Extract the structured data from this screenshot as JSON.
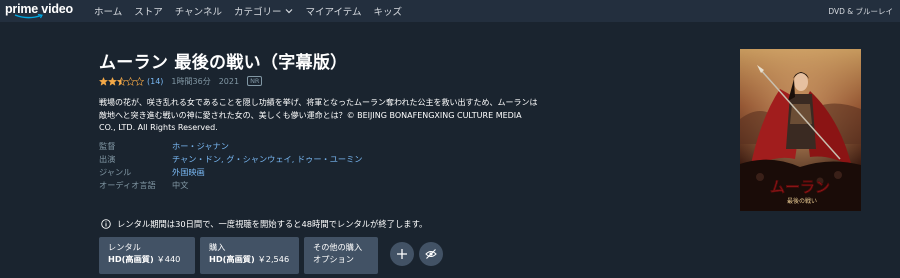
{
  "nav": {
    "logo": "prime video",
    "items": [
      "ホーム",
      "ストア",
      "チャンネル",
      "カテゴリー",
      "マイアイテム",
      "キッズ"
    ],
    "right_link": "DVD & ブルーレイ"
  },
  "movie": {
    "title": "ムーラン 最後の戦い（字幕版）",
    "rating_stars": 2.5,
    "rating_max": 5,
    "rating_count": "(14)",
    "duration": "1時間36分",
    "year": "2021",
    "maturity": "NR",
    "synopsis": "戦場の花が、咲き乱れる女であることを隠し功績を挙げ、将軍となったムーラン奪われた公主を救い出すため、ムーランは敵地へと突き進む戦いの神に愛された女の、美しくも儚い運命とは？© BEIJING BONAFENGXING CULTURE MEDIA CO., LTD. All Rights Reserved.",
    "details": [
      {
        "label": "監督",
        "value": "ホー・ジャナン",
        "link": true
      },
      {
        "label": "出演",
        "value": "チャン・ドン, グ・シャンウェイ, ドゥー・ユーミン",
        "link": true
      },
      {
        "label": "ジャンル",
        "value": "外国映画",
        "link": true
      },
      {
        "label": "オーディオ言語",
        "value": "中文",
        "link": false
      }
    ],
    "poster_title": "ムーラン",
    "poster_subtitle": "最後の戦い"
  },
  "notice": "レンタル期間は30日間で、一度視聴を開始すると48時間でレンタルが終了します。",
  "buttons": {
    "rent": {
      "line1": "レンタル",
      "quality": "HD(高画質)",
      "price": "￥440"
    },
    "buy": {
      "line1": "購入",
      "quality": "HD(高画質)",
      "price": "￥2,546"
    },
    "other": {
      "line1": "その他の購入",
      "line2": "オプション"
    }
  },
  "colors": {
    "background": "#1a242f",
    "navbar": "#232f3e",
    "link": "#79b8f3",
    "muted": "#8197a4",
    "button": "#425265",
    "star": "#f3a847"
  }
}
